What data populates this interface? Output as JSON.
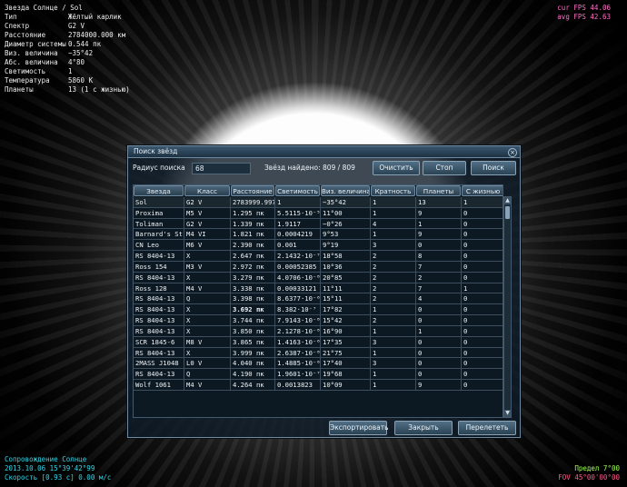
{
  "info": {
    "title": "Звезда  Солнце / Sol",
    "rows": [
      {
        "k": "Тип",
        "v": "Жёлтый карлик"
      },
      {
        "k": "Спектр",
        "v": "G2 V"
      },
      {
        "k": "Расстояние",
        "v": "2784000.000 км"
      },
      {
        "k": "Диаметр системы",
        "v": "0.544 пк"
      },
      {
        "k": "Виз. величина",
        "v": "−35°42"
      },
      {
        "k": "Абс. величина",
        "v": "4°80"
      },
      {
        "k": "Светимость",
        "v": "1"
      },
      {
        "k": "Температура",
        "v": "5860 K"
      },
      {
        "k": "Планеты",
        "v": "13 (1 с жизнью)"
      }
    ]
  },
  "fps": {
    "cur": "cur FPS 44.06",
    "avg": "avg FPS 42.63"
  },
  "bottom_left": {
    "line1": "Сопровождение Солнце",
    "line2": "2013.10.06 15°39'42°99",
    "line3": "Скорость [0.93 c] 0.00 м/с"
  },
  "bottom_right": {
    "line1": "Предел    7°00",
    "line2": "FOV 45°00'00°00"
  },
  "dialog": {
    "title": "Поиск звёзд",
    "close_glyph": "×",
    "radius_label": "Радиус поиска",
    "radius_value": "68",
    "found_label": "Звёзд найдено: 809 / 809",
    "buttons": {
      "clear": "Очистить",
      "stop": "Стоп",
      "search": "Поиск",
      "export": "Экспортировать",
      "close": "Закрыть",
      "goto": "Перелететь"
    },
    "columns": [
      "Звезда",
      "Класс",
      "Расстояние",
      "Светимость",
      "Виз. величина",
      "Кратность",
      "Планеты",
      "С жизнью"
    ],
    "rows": [
      [
        "Sol",
        "G2 V",
        "2783999.997",
        "1",
        "−35°42",
        "1",
        "13",
        "1"
      ],
      [
        "Proxima",
        "M5 V",
        "1.295 пк",
        "5.5115·10⁻⁵",
        "11°00",
        "1",
        "9",
        "0"
      ],
      [
        "Toliman",
        "G2 V",
        "1.339 пк",
        "1.9117",
        "−0°26",
        "4",
        "1",
        "0"
      ],
      [
        "Barnard's St",
        "M4 VI",
        "1.821 пк",
        "0.0004219",
        "9°53",
        "1",
        "9",
        "0"
      ],
      [
        "CN Leo",
        "M6 V",
        "2.390 пк",
        "0.001",
        "9°19",
        "3",
        "0",
        "0"
      ],
      [
        "RS 8404-13",
        "X",
        "2.647 пк",
        "2.1432·10⁻⁷",
        "18°58",
        "2",
        "8",
        "0"
      ],
      [
        "Ross 154",
        "M3 V",
        "2.972 пк",
        "0.00052385",
        "10°36",
        "2",
        "7",
        "0"
      ],
      [
        "RS 8404-13",
        "X",
        "3.279 пк",
        "4.0706·10⁻⁸",
        "20°85",
        "2",
        "2",
        "0"
      ],
      [
        "Ross 128",
        "M4 V",
        "3.338 пк",
        "0.00033121",
        "11°11",
        "2",
        "7",
        "1"
      ],
      [
        "RS 8404-13",
        "Q",
        "3.398 пк",
        "8.6377·10⁻⁶",
        "15°11",
        "2",
        "4",
        "0"
      ],
      [
        "RS 8404-13",
        "X",
        "3.692 пк",
        "8.382·10⁻⁷",
        "17°82",
        "1",
        "0",
        "0"
      ],
      [
        "RS 8404-13",
        "X",
        "3.744 пк",
        "7.9143·10⁻⁸",
        "15°42",
        "2",
        "0",
        "0"
      ],
      [
        "RS 8404-13",
        "X",
        "3.850 пк",
        "2.1278·10⁻⁸",
        "16°90",
        "1",
        "1",
        "0"
      ],
      [
        "SCR 1845-6",
        "M8 V",
        "3.865 пк",
        "1.4163·10⁻⁶",
        "17°35",
        "3",
        "0",
        "0"
      ],
      [
        "RS 8404-13",
        "X",
        "3.999 пк",
        "2.6387·10⁻⁸",
        "21°75",
        "1",
        "0",
        "0"
      ],
      [
        "2MASS J1048",
        "L0 V",
        "4.040 пк",
        "1.4885·10⁻⁶",
        "17°40",
        "3",
        "0",
        "0"
      ],
      [
        "RS 8404-13",
        "Q",
        "4.190 пк",
        "1.9601·10⁻⁷",
        "19°68",
        "1",
        "0",
        "0"
      ],
      [
        "Wolf 1061",
        "M4 V",
        "4.264 пк",
        "0.0013823",
        "10°09",
        "1",
        "9",
        "0"
      ]
    ],
    "scroll_up": "▲",
    "scroll_down": "▼"
  }
}
